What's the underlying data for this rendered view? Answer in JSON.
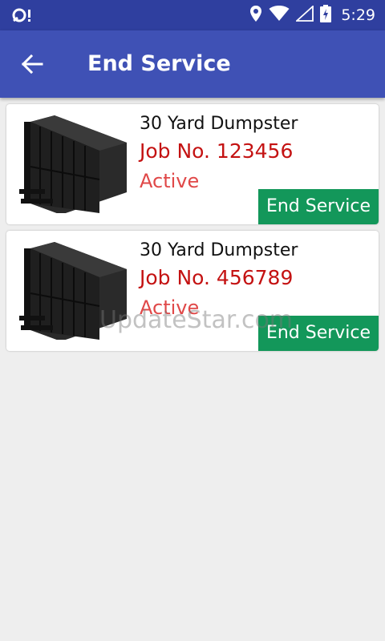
{
  "status_bar": {
    "time": "5:29",
    "icons": [
      "notification-icon",
      "location-icon",
      "wifi-icon",
      "signal-icon",
      "battery-icon"
    ]
  },
  "app_bar": {
    "title": "End Service",
    "back_icon": "arrow-back-icon"
  },
  "colors": {
    "status_bar": "#2f3f9f",
    "app_bar": "#3f51b5",
    "job_number": "#c41212",
    "status_text": "#e04848",
    "end_button": "#13975a",
    "background": "#eeeeee"
  },
  "services": [
    {
      "item": "30 Yard Dumpster",
      "job": "Job No. 123456",
      "status": "Active",
      "action": "End Service"
    },
    {
      "item": "30 Yard Dumpster",
      "job": "Job No. 456789",
      "status": "Active",
      "action": "End Service"
    }
  ],
  "watermark": "UpdateStar.com"
}
